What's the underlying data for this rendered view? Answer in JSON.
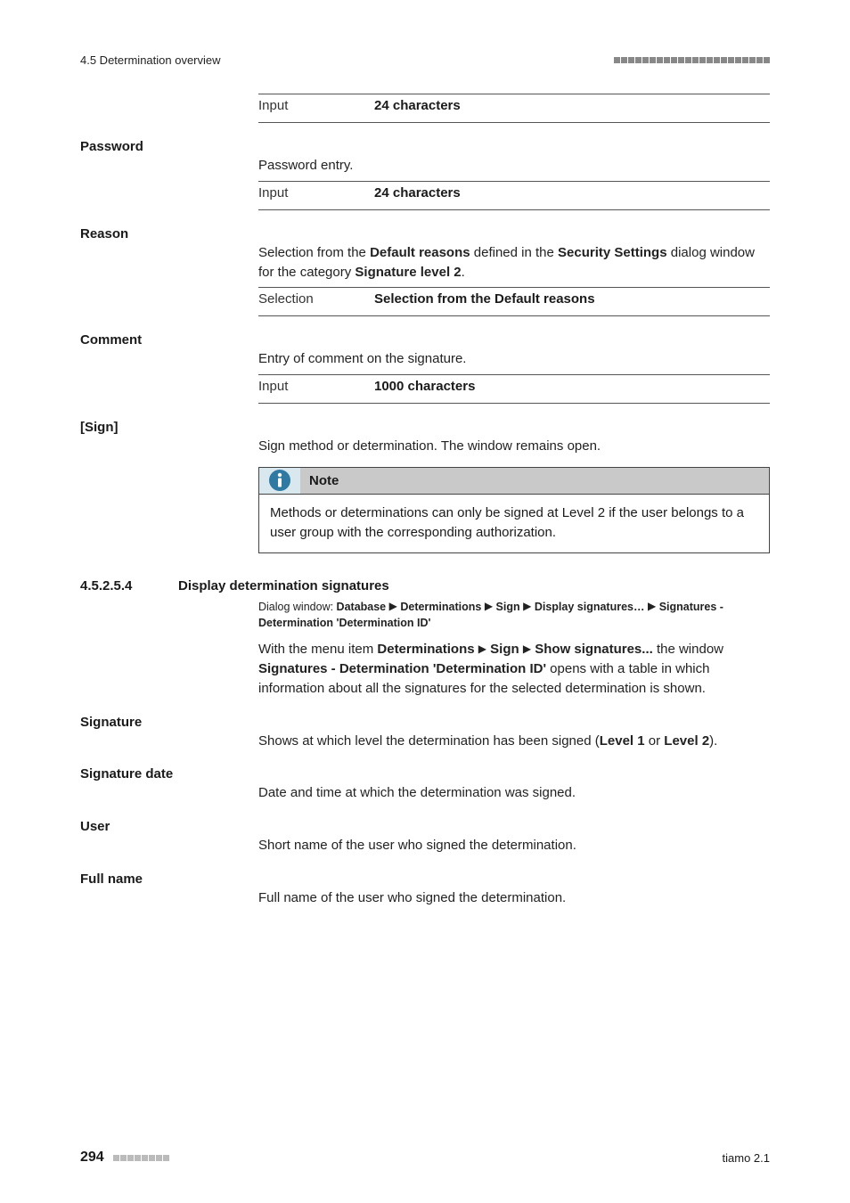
{
  "header": {
    "section_label": "4.5 Determination overview"
  },
  "rows": {
    "input_label": "Input",
    "selection_label": "Selection",
    "chars24": "24 characters",
    "chars1000": "1000 characters",
    "selection_default": "Selection from the Default reasons"
  },
  "fields": {
    "password": {
      "label": "Password",
      "body": "Password entry."
    },
    "reason": {
      "label": "Reason",
      "pre": "Selection from the ",
      "b1": "Default reasons",
      "mid1": " defined in the ",
      "b2": "Security Settings",
      "mid2": " dialog window for the category ",
      "b3": "Signature level 2",
      "end": "."
    },
    "comment": {
      "label": "Comment",
      "body": "Entry of comment on the signature."
    },
    "sign": {
      "label": "[Sign]",
      "body": "Sign method or determination. The window remains open."
    },
    "note": {
      "title": "Note",
      "body": "Methods or determinations can only be signed at Level 2 if the user belongs to a user group with the corresponding authorization."
    },
    "section": {
      "num": "4.5.2.5.4",
      "title": "Display determination signatures"
    },
    "dialog": {
      "lead": "Dialog window: ",
      "p1": "Database",
      "p2": "Determinations",
      "p3": "Sign",
      "p4": "Display signatures…",
      "p5": "Signatures - Determination 'Determination ID'",
      "arrow": "▶"
    },
    "menu": {
      "pre": "With the menu item ",
      "b1": "Determinations",
      "arrow": "▶",
      "b2": "Sign",
      "b3": "Show signatures...",
      "mid": " the window ",
      "b4": "Signatures - Determination 'Determination ID'",
      "post": " opens with a table in which information about all the signatures for the selected determination is shown."
    },
    "signature": {
      "label": "Signature",
      "pre": "Shows at which level the determination has been signed (",
      "b1": "Level 1",
      "mid": " or ",
      "b2": "Level 2",
      "post": ")."
    },
    "sigdate": {
      "label": "Signature date",
      "body": "Date and time at which the determination was signed."
    },
    "user": {
      "label": "User",
      "body": "Short name of the user who signed the determination."
    },
    "fullname": {
      "label": "Full name",
      "body": "Full name of the user who signed the determination."
    }
  },
  "footer": {
    "page": "294",
    "product": "tiamo 2.1"
  }
}
